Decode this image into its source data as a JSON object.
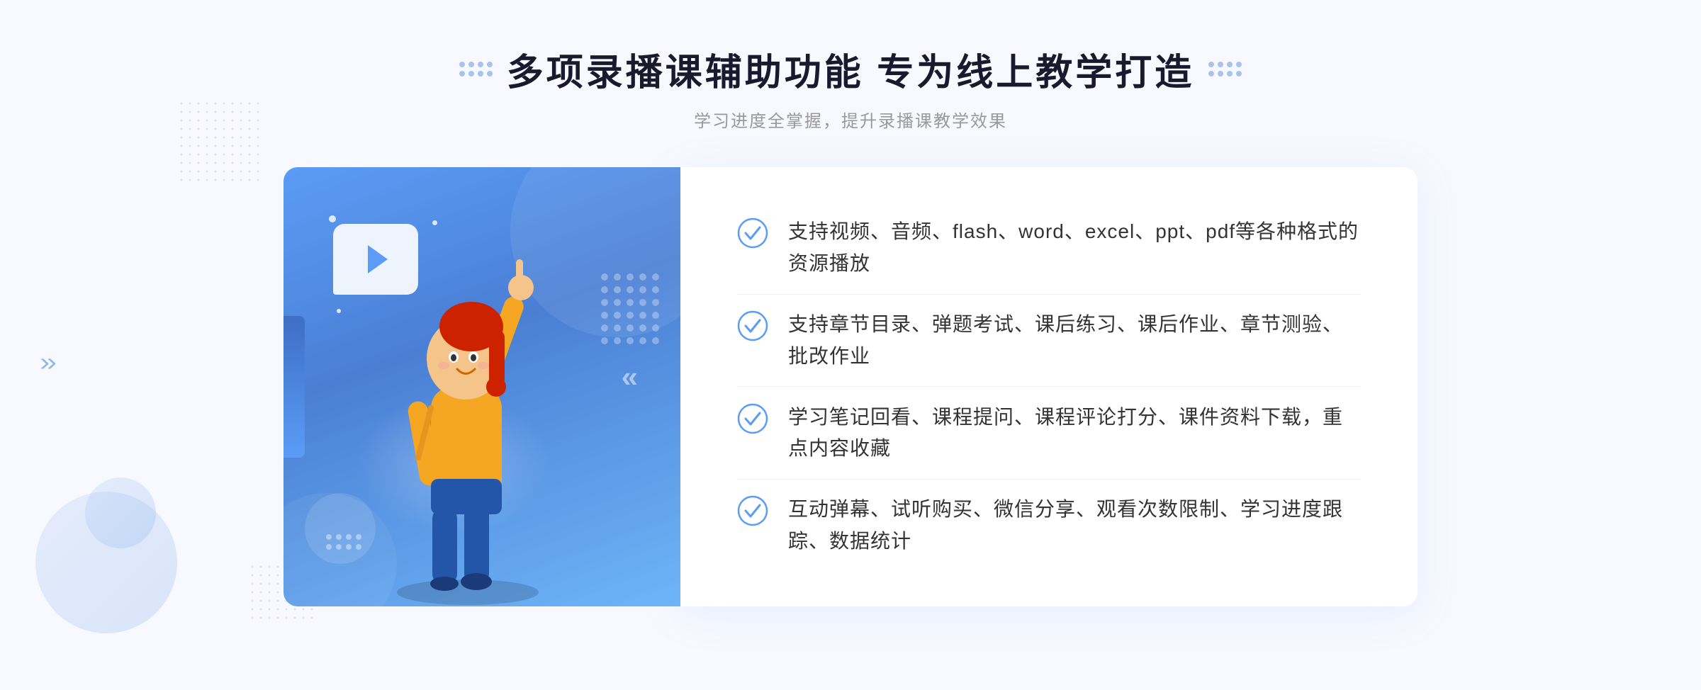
{
  "page": {
    "background_color": "#f5f7fc"
  },
  "header": {
    "title": "多项录播课辅助功能 专为线上教学打造",
    "subtitle": "学习进度全掌握，提升录播课教学效果",
    "dot_grid_count": 8
  },
  "features": [
    {
      "id": 1,
      "text": "支持视频、音频、flash、word、excel、ppt、pdf等各种格式的资源播放"
    },
    {
      "id": 2,
      "text": "支持章节目录、弹题考试、课后练习、课后作业、章节测验、批改作业"
    },
    {
      "id": 3,
      "text": "学习笔记回看、课程提问、课程评论打分、课件资料下载，重点内容收藏"
    },
    {
      "id": 4,
      "text": "互动弹幕、试听购买、微信分享、观看次数限制、学习进度跟踪、数据统计"
    }
  ],
  "icons": {
    "check_circle": "check-circle-icon",
    "play": "play-icon",
    "arrow": "arrow-icon"
  },
  "colors": {
    "primary_blue": "#5b9cf6",
    "dark_blue": "#3d6fc4",
    "light_blue": "#a8c8f8",
    "text_dark": "#333333",
    "text_gray": "#999999",
    "white": "#ffffff",
    "bg_light": "#f5f7fc"
  }
}
